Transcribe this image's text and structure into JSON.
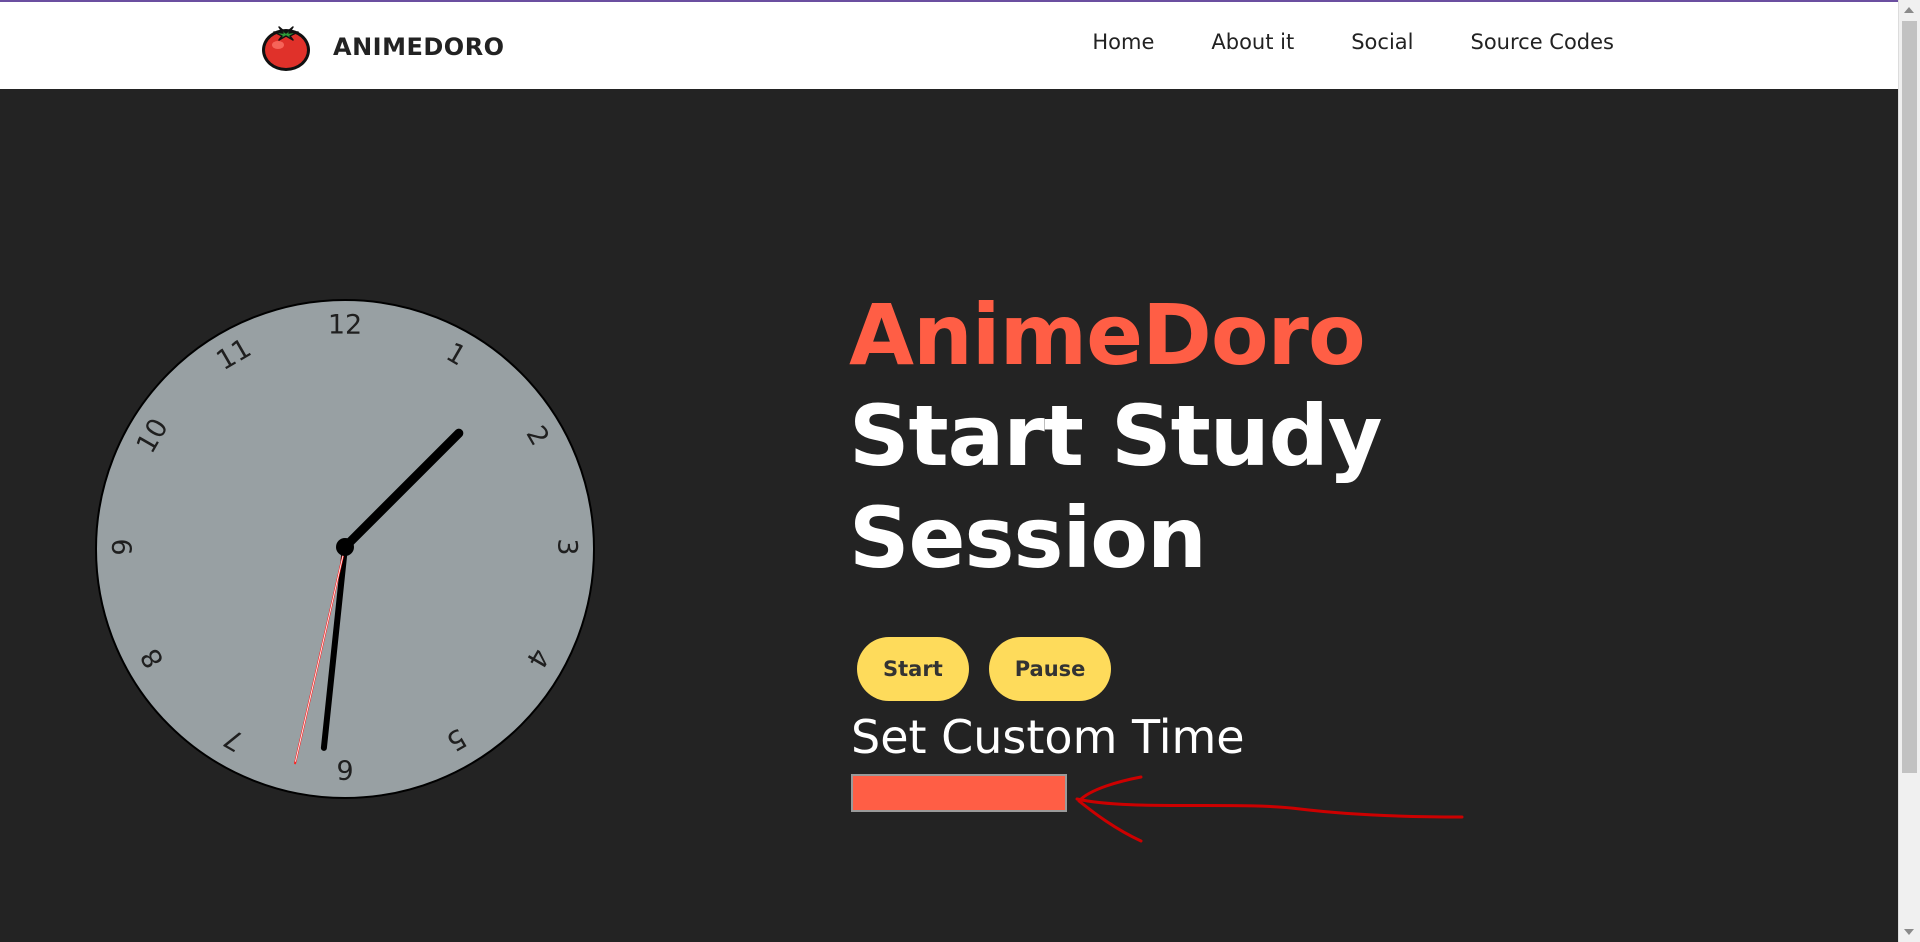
{
  "nav": {
    "brand": "ANIMEDORO",
    "links": [
      "Home",
      "About it",
      "Social",
      "Source Codes"
    ]
  },
  "clock": {
    "numbers": [
      "12",
      "1",
      "2",
      "3",
      "4",
      "5",
      "6",
      "7",
      "8",
      "9",
      "10",
      "11"
    ],
    "face_color": "#98a0a3",
    "time_shown": {
      "hour": 1.5,
      "minute": 31,
      "second": 31.5
    }
  },
  "hero": {
    "title_accent": "AnimeDoro",
    "title_line1": "Start Study",
    "title_line2": "Session"
  },
  "controls": {
    "start_label": "Start",
    "pause_label": "Pause",
    "custom_time_label": "Set Custom Time",
    "custom_time_value": ""
  },
  "colors": {
    "accent": "#ff5e45",
    "button": "#fedb5b",
    "background": "#232323",
    "annotation": "#cc0000"
  }
}
